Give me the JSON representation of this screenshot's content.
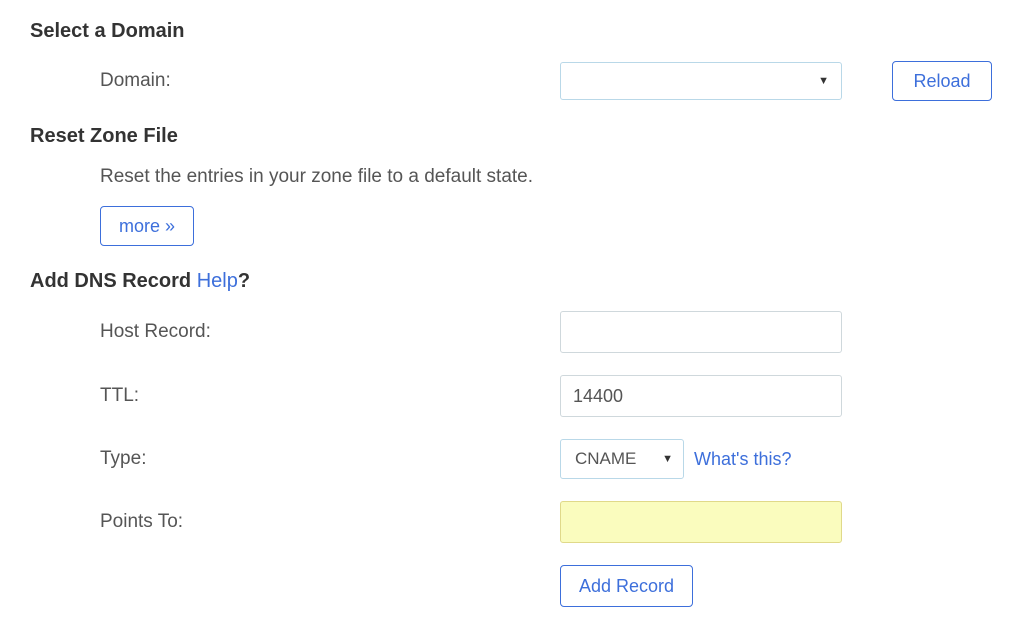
{
  "sections": {
    "select_domain": {
      "title": "Select a Domain",
      "domain_label": "Domain:",
      "reload_label": "Reload"
    },
    "reset_zone": {
      "title": "Reset Zone File",
      "description": "Reset the entries in your zone file to a default state.",
      "more_label": "more »"
    },
    "add_dns": {
      "title": "Add DNS Record ",
      "help_label": "Help",
      "help_suffix": "?",
      "fields": {
        "host_record_label": "Host Record:",
        "host_record_value": "",
        "ttl_label": "TTL:",
        "ttl_value": "14400",
        "type_label": "Type:",
        "type_value": "CNAME",
        "whats_this": "What's this?",
        "points_to_label": "Points To:",
        "points_to_value": ""
      },
      "add_record_label": "Add Record"
    }
  }
}
